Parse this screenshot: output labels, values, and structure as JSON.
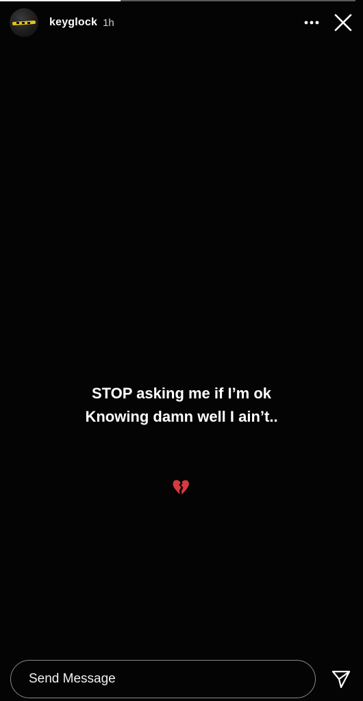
{
  "story": {
    "progress": 0.34,
    "background_color": "#040404"
  },
  "header": {
    "avatar_icon": "profile-avatar",
    "username": "keyglock",
    "time_ago": "1h",
    "more_icon": "more-horizontal-icon",
    "close_icon": "close-icon"
  },
  "content": {
    "caption_lines": [
      "STOP asking me if I’m ok",
      "Knowing damn well I ain’t.."
    ],
    "sticker_icon": "broken-heart-icon",
    "sticker_color": "#d63a3f"
  },
  "footer": {
    "message_placeholder": "Send Message",
    "send_icon": "send-icon"
  }
}
